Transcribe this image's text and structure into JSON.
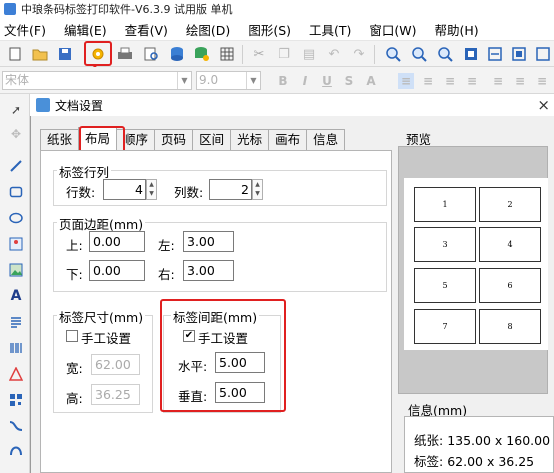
{
  "app": {
    "title": "中琅条码标签打印软件-V6.3.9 试用版 单机"
  },
  "menu": [
    "文件(F)",
    "编辑(E)",
    "查看(V)",
    "绘图(D)",
    "图形(S)",
    "工具(T)",
    "窗口(W)",
    "帮助(H)"
  ],
  "fontbar": {
    "font_name": "宋体",
    "font_size": "9.0"
  },
  "dialog": {
    "title": "文档设置",
    "close": "×"
  },
  "tabs": [
    "纸张",
    "布局",
    "顺序",
    "页码",
    "区间",
    "光标",
    "画布",
    "信息"
  ],
  "layout": {
    "rows_group": {
      "title": "标签行列",
      "rows_label": "行数:",
      "rows_value": "4",
      "cols_label": "列数:",
      "cols_value": "2"
    },
    "margin_group": {
      "title": "页面边距(mm)",
      "top_label": "上:",
      "top_value": "0.00",
      "left_label": "左:",
      "left_value": "3.00",
      "bottom_label": "下:",
      "bottom_value": "0.00",
      "right_label": "右:",
      "right_value": "3.00"
    },
    "size_group": {
      "title": "标签尺寸(mm)",
      "manual_label": "手工设置",
      "manual_checked": false,
      "width_label": "宽:",
      "width_value": "62.00",
      "height_label": "高:",
      "height_value": "36.25"
    },
    "spacing_group": {
      "title": "标签间距(mm)",
      "manual_label": "手工设置",
      "manual_checked": true,
      "h_label": "水平:",
      "h_value": "5.00",
      "v_label": "垂直:",
      "v_value": "5.00"
    }
  },
  "preview": {
    "title": "预览",
    "labels": [
      "1",
      "2",
      "3",
      "4",
      "5",
      "6",
      "7",
      "8"
    ]
  },
  "info": {
    "title": "信息(mm)",
    "paper_label": "纸张:",
    "paper_value": "135.00 x 160.00",
    "label_label": "标签:",
    "label_value": "62.00 x 36.25"
  },
  "colors": {
    "highlight": "#e02020",
    "accent": "#3d7fd6"
  }
}
